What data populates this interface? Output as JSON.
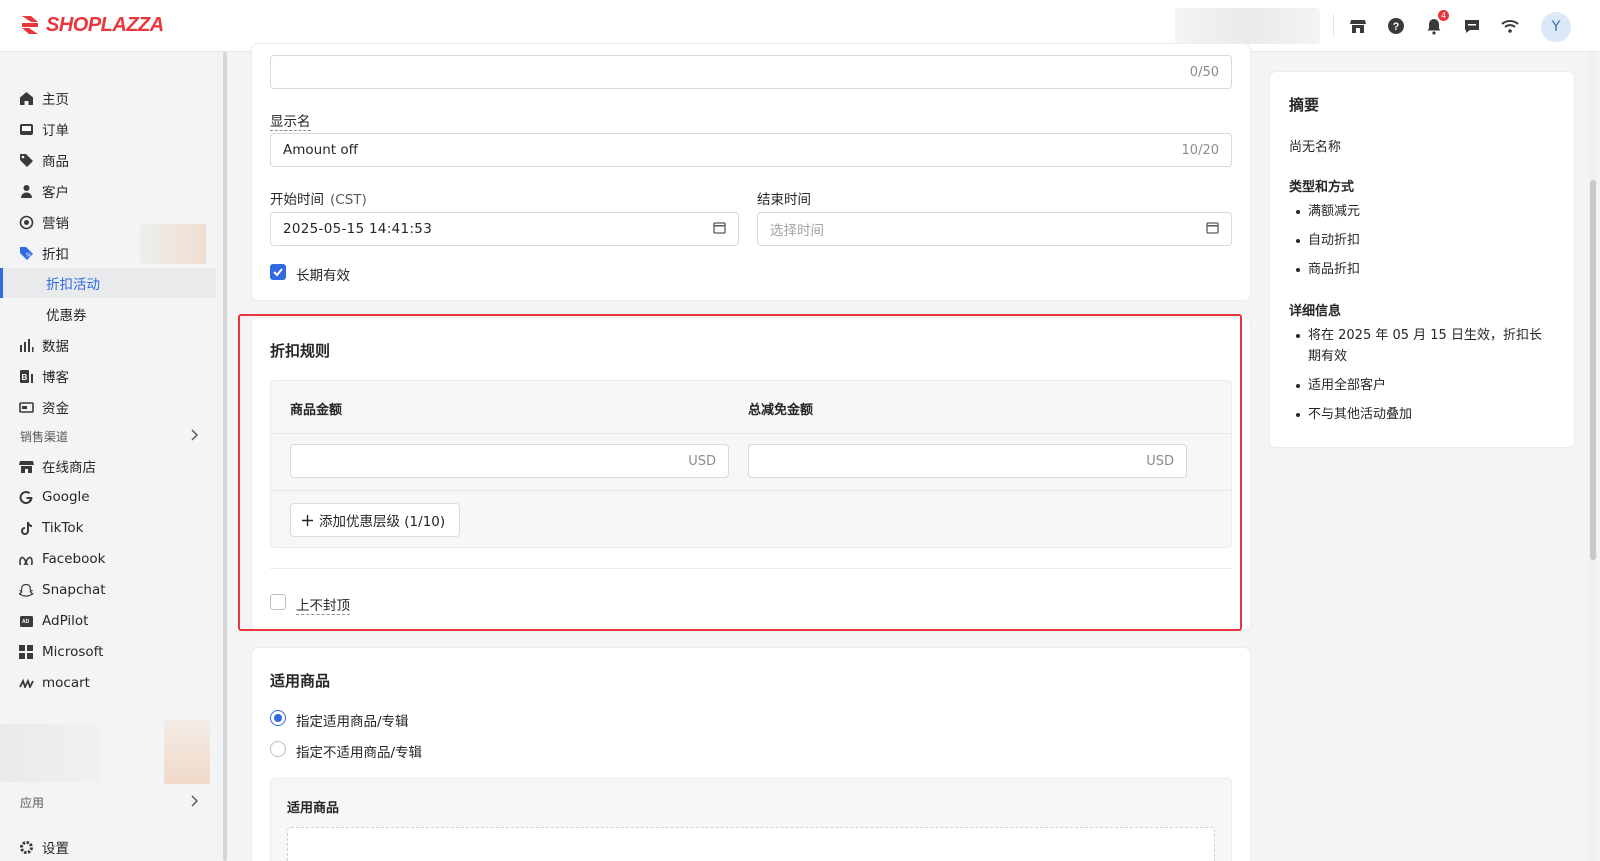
{
  "brand": {
    "logo_text": "SHOPLAZZA",
    "accent": "#e8363c",
    "primary": "#2f6ae1"
  },
  "topbar": {
    "notification_count": "4",
    "avatar_initial": "Y"
  },
  "sidebar": {
    "items": [
      {
        "label": "主页",
        "icon": "home-icon"
      },
      {
        "label": "订单",
        "icon": "inbox-icon"
      },
      {
        "label": "商品",
        "icon": "tag-icon"
      },
      {
        "label": "客户",
        "icon": "person-icon"
      },
      {
        "label": "营销",
        "icon": "target-icon"
      },
      {
        "label": "折扣",
        "icon": "discount-icon"
      }
    ],
    "discount_sub": [
      {
        "label": "折扣活动",
        "active": true
      },
      {
        "label": "优惠券",
        "active": false
      }
    ],
    "items2": [
      {
        "label": "数据",
        "icon": "bar-chart-icon"
      },
      {
        "label": "博客",
        "icon": "blog-icon"
      },
      {
        "label": "资金",
        "icon": "wallet-icon"
      }
    ],
    "sales_channels_label": "销售渠道",
    "channels": [
      {
        "label": "在线商店",
        "icon": "store-icon"
      },
      {
        "label": "Google",
        "icon": "google-icon"
      },
      {
        "label": "TikTok",
        "icon": "tiktok-icon"
      },
      {
        "label": "Facebook",
        "icon": "meta-icon"
      },
      {
        "label": "Snapchat",
        "icon": "snapchat-icon"
      },
      {
        "label": "AdPilot",
        "icon": "adpilot-icon"
      },
      {
        "label": "Microsoft",
        "icon": "microsoft-icon"
      },
      {
        "label": "mocart",
        "icon": "mocart-icon"
      }
    ],
    "apps_label": "应用",
    "settings_label": "设置"
  },
  "form": {
    "name_count": "0/50",
    "display_name_label": "显示名",
    "display_name_value": "Amount off",
    "display_name_count": "10/20",
    "start_label": "开始时间",
    "start_tz": "(CST)",
    "start_value": "2025-05-15 14:41:53",
    "end_label": "结束时间",
    "end_placeholder": "选择时间",
    "long_term_label": "长期有效"
  },
  "rules": {
    "title": "折扣规则",
    "col_amount": "商品金额",
    "col_discount": "总减免金额",
    "currency": "USD",
    "add_tier_label": "添加优惠层级 (1/10)",
    "no_cap_label": "上不封顶"
  },
  "products": {
    "title": "适用商品",
    "option_include": "指定适用商品/专辑",
    "option_exclude": "指定不适用商品/专辑",
    "sub_title": "适用商品"
  },
  "summary": {
    "title": "摘要",
    "no_name": "尚无名称",
    "type_head": "类型和方式",
    "types": [
      "满额减元",
      "自动折扣",
      "商品折扣"
    ],
    "detail_head": "详细信息",
    "details": [
      "将在 2025 年 05 月 15 日生效，折扣长",
      "期有效",
      "适用全部客户",
      "不与其他活动叠加"
    ]
  }
}
